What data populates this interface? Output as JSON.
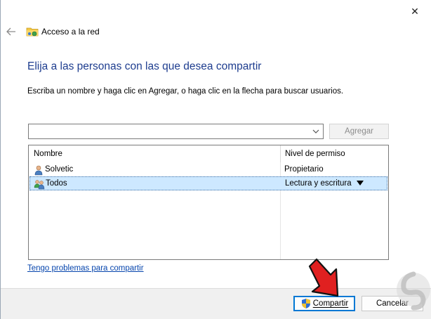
{
  "window": {
    "title": "Acceso a la red",
    "close_symbol": "✕",
    "back_symbol": "←"
  },
  "main": {
    "heading": "Elija a las personas con las que desea compartir",
    "instruction": "Escriba un nombre y haga clic en Agregar, o haga clic en la flecha para buscar usuarios.",
    "combo_value": "",
    "add_label": "Agregar"
  },
  "list": {
    "columns": [
      "Nombre",
      "Nivel de permiso"
    ],
    "rows": [
      {
        "name": "Solvetic",
        "permission": "Propietario",
        "icon": "user-icon"
      },
      {
        "name": "Todos",
        "permission": "Lectura y escritura",
        "icon": "group-icon"
      }
    ]
  },
  "links": {
    "help": "Tengo problemas para compartir"
  },
  "footer": {
    "share_label": "Compartir",
    "share_underline": "C",
    "cancel_label": "Cancelar"
  },
  "colors": {
    "heading": "#1e3d8f",
    "selection": "#cde8ff",
    "accent": "#0078d4",
    "link": "#0645ad",
    "arrow": "#e02020"
  }
}
